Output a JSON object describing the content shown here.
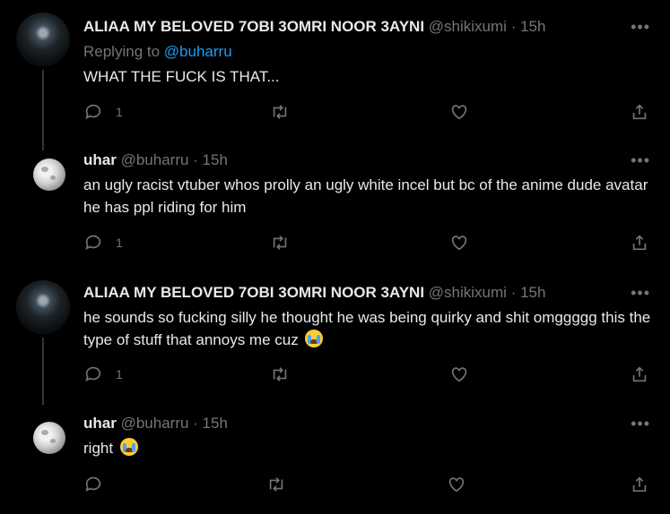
{
  "tweets": [
    {
      "name": "ALIAA MY BELOVED 7OBI 3OMRI NOOR 3AYNI",
      "handle": "@shikixumi",
      "time": "· 15h",
      "replying_label": "Replying to",
      "replying_handle": "@buharru",
      "text": "WHAT THE FUCK IS THAT...",
      "reply_count": "1"
    },
    {
      "name": "uhar",
      "handle": "@buharru",
      "time": "· 15h",
      "text": "an ugly racist vtuber whos prolly an ugly white incel but bc of the anime dude avatar he has ppl riding for him",
      "reply_count": "1"
    },
    {
      "name": "ALIAA MY BELOVED 7OBI 3OMRI NOOR 3AYNI",
      "handle": "@shikixumi",
      "time": "· 15h",
      "text": "he sounds so fucking silly he thought he was being quirky and shit omggggg this the type of stuff that annoys me cuz",
      "reply_count": "1"
    },
    {
      "name": "uhar",
      "handle": "@buharru",
      "time": "· 15h",
      "text": "right",
      "reply_count": ""
    }
  ],
  "more_label": "•••",
  "icons": {
    "reply": "reply-icon",
    "retweet": "retweet-icon",
    "like": "heart-icon",
    "share": "share-icon",
    "emoji": "loudly-crying-face-emoji"
  }
}
